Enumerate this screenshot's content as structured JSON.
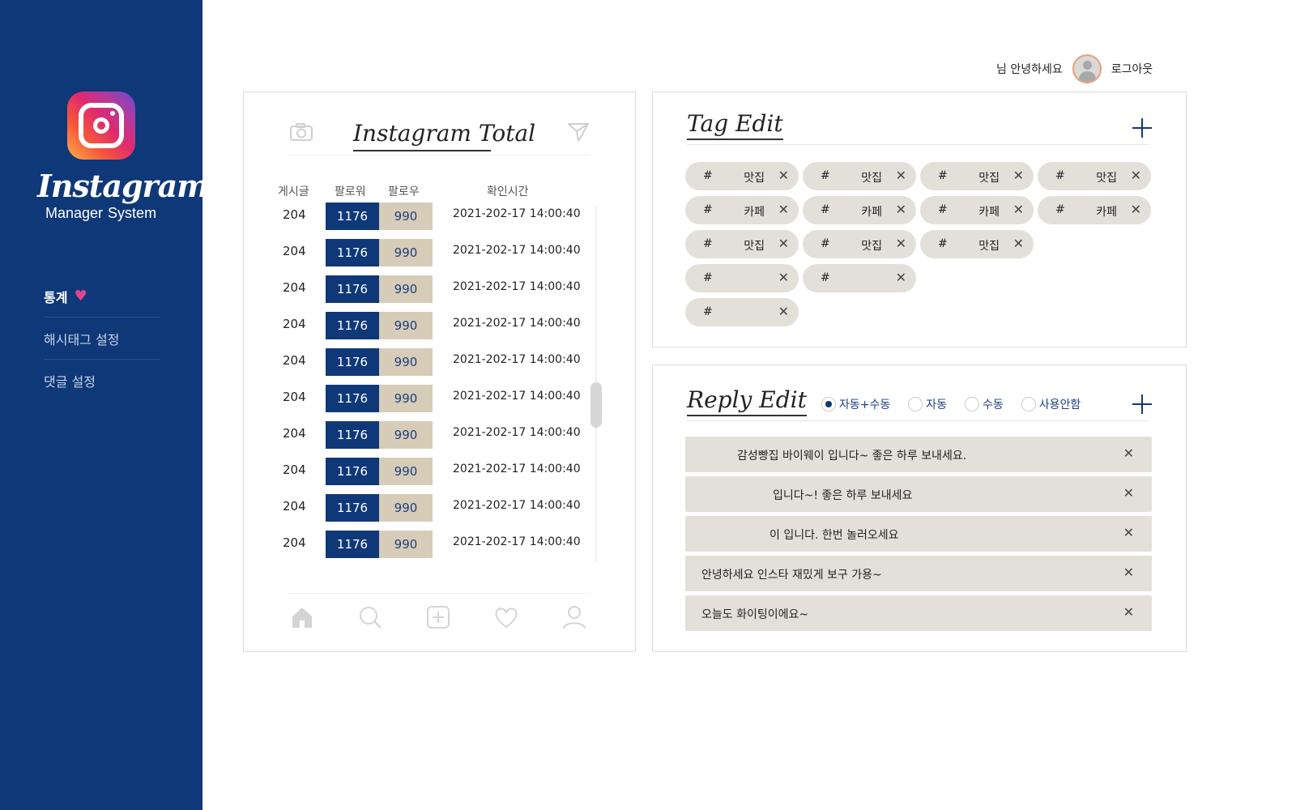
{
  "sidebar": {
    "brand_script": "Instagram",
    "brand_sub": [
      "Manager",
      "System"
    ],
    "nav": [
      {
        "label": "통계",
        "active": true,
        "icon": "heart-icon"
      },
      {
        "label": "해시태그 설정",
        "active": false
      },
      {
        "label": "댓글 설정",
        "active": false
      }
    ]
  },
  "userbar": {
    "greeting": "님 안녕하세요",
    "logout": "로그아웃"
  },
  "total": {
    "title": "Instagram Total",
    "headers": {
      "posts": "게시글",
      "followers": "팔로워",
      "following": "팔로우",
      "time": "확인시간"
    },
    "rows": [
      {
        "posts": "204",
        "followers": "1176",
        "following": "990",
        "time": "2021-202-17 14:00:40"
      },
      {
        "posts": "204",
        "followers": "1176",
        "following": "990",
        "time": "2021-202-17 14:00:40"
      },
      {
        "posts": "204",
        "followers": "1176",
        "following": "990",
        "time": "2021-202-17 14:00:40"
      },
      {
        "posts": "204",
        "followers": "1176",
        "following": "990",
        "time": "2021-202-17 14:00:40"
      },
      {
        "posts": "204",
        "followers": "1176",
        "following": "990",
        "time": "2021-202-17 14:00:40"
      },
      {
        "posts": "204",
        "followers": "1176",
        "following": "990",
        "time": "2021-202-17 14:00:40"
      },
      {
        "posts": "204",
        "followers": "1176",
        "following": "990",
        "time": "2021-202-17 14:00:40"
      },
      {
        "posts": "204",
        "followers": "1176",
        "following": "990",
        "time": "2021-202-17 14:00:40"
      },
      {
        "posts": "204",
        "followers": "1176",
        "following": "990",
        "time": "2021-202-17 14:00:40"
      },
      {
        "posts": "204",
        "followers": "1176",
        "following": "990",
        "time": "2021-202-17 14:00:40"
      }
    ]
  },
  "tag_edit": {
    "title": "Tag Edit",
    "tags": [
      {
        "hash": "#",
        "name": "맛집"
      },
      {
        "hash": "#",
        "name": "맛집"
      },
      {
        "hash": "#",
        "name": "맛집"
      },
      {
        "hash": "#",
        "name": "맛집"
      },
      {
        "hash": "#",
        "name": "카페"
      },
      {
        "hash": "#",
        "name": "카페"
      },
      {
        "hash": "#",
        "name": "카페"
      },
      {
        "hash": "#",
        "name": "카페"
      },
      {
        "hash": "#",
        "name": "맛집"
      },
      {
        "hash": "#",
        "name": "맛집"
      },
      {
        "hash": "#",
        "name": "맛집"
      },
      {
        "hash": "#",
        "name": ""
      },
      {
        "hash": "#",
        "name": ""
      },
      {
        "hash": "#",
        "name": ""
      }
    ]
  },
  "reply_edit": {
    "title": "Reply Edit",
    "modes": [
      {
        "label": "자동+수동",
        "selected": true
      },
      {
        "label": "자동",
        "selected": false
      },
      {
        "label": "수동",
        "selected": false
      },
      {
        "label": "사용안함",
        "selected": false
      }
    ],
    "replies": [
      {
        "text": "감성빵집 바이웨이 입니다~ 좋은 하루 보내세요.",
        "indent": 64
      },
      {
        "text": "입니다~! 좋은 하루 보내세요",
        "indent": 108
      },
      {
        "text": "이 입니다. 한번 놀러오세요",
        "indent": 104
      },
      {
        "text": "안녕하세요 인스타 재밌게 보구 가용~",
        "indent": 20
      },
      {
        "text": "오늘도 화이팅이에요~",
        "indent": 20
      }
    ]
  },
  "colors": {
    "brand_navy": "#0f3878",
    "beige": "#d6ccb8",
    "chip": "#e3e0da",
    "heart": "#e0458f"
  }
}
